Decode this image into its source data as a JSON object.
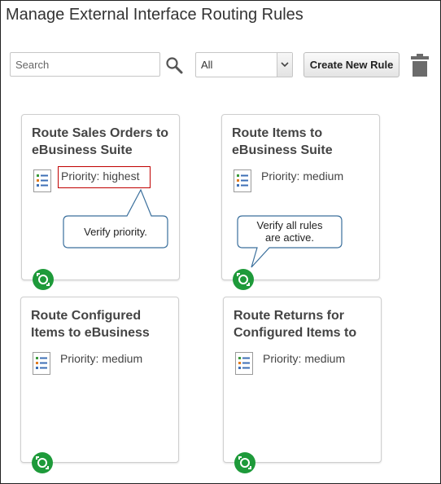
{
  "page": {
    "title": "Manage External Interface Routing Rules"
  },
  "toolbar": {
    "search_placeholder": "Search",
    "search_icon": "magnifier",
    "filter_value": "All",
    "create_label": "Create New Rule",
    "delete_icon": "trash-can"
  },
  "cards": [
    {
      "title": "Route Sales Orders to\neBusiness Suite",
      "priority": "Priority: highest",
      "status_icon": "active-routing-badge"
    },
    {
      "title": "Route Items to\neBusiness Suite",
      "priority": "Priority: medium",
      "status_icon": "active-routing-badge"
    },
    {
      "title": "Route Configured\nItems to eBusiness",
      "priority": "Priority: medium",
      "status_icon": "active-routing-badge"
    },
    {
      "title": "Route Returns for\nConfigured Items to",
      "priority": "Priority: medium",
      "status_icon": "active-routing-badge"
    }
  ],
  "callouts": {
    "priority_note": "Verify priority.",
    "active_note": "Verify all rules\nare active."
  },
  "colors": {
    "badge_green": "#1e9a3a",
    "highlight_red": "#c00000",
    "callout_border": "#3a6f9c"
  }
}
